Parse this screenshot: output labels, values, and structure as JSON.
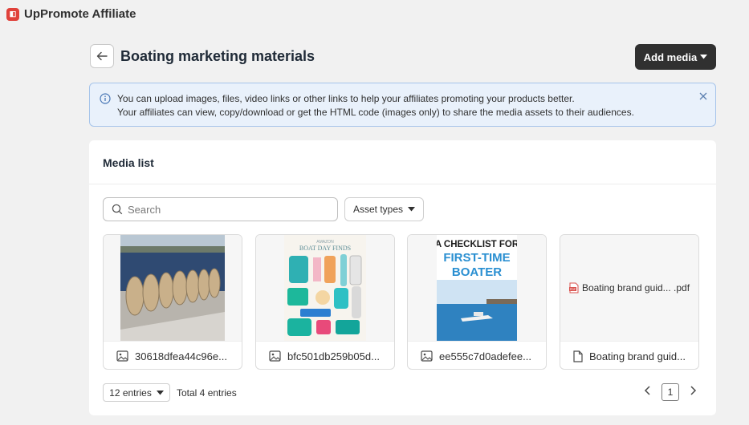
{
  "app": {
    "title": "UpPromote Affiliate",
    "logo_icon": "uppromote-logo-icon"
  },
  "header": {
    "title": "Boating marketing materials",
    "add_media_label": "Add media"
  },
  "banner": {
    "line1": "You can upload images, files, video links or other links to help your affiliates promoting your products better.",
    "line2": "Your affiliates can view, copy/download or get the HTML code (images only) to share the media assets to their audiences."
  },
  "media_list": {
    "title": "Media list",
    "search_placeholder": "Search",
    "asset_types_label": "Asset types",
    "items": [
      {
        "name": "30618dfea44c96e...",
        "type": "image",
        "icon": "image-icon"
      },
      {
        "name": "bfc501db259b05d...",
        "type": "image",
        "icon": "image-icon",
        "thumb_text_1": "AMAZON",
        "thumb_text_2": "BOAT DAY FINDS"
      },
      {
        "name": "ee555c7d0adefee...",
        "type": "image",
        "icon": "image-icon",
        "thumb_text_1": "A CHECKLIST FOR",
        "thumb_text_2": "FIRST-TIME",
        "thumb_text_3": "BOATER"
      },
      {
        "name": "Boating brand guid...",
        "type": "file",
        "icon": "file-icon",
        "thumb_label": "Boating brand guid... .pdf"
      }
    ],
    "entries_label": "12 entries",
    "total_label": "Total 4 entries",
    "current_page": "1"
  },
  "colors": {
    "primary_button": "#303030",
    "banner_bg": "#e9f1fb",
    "banner_border": "#a6c4ea",
    "logo": "#e0413a",
    "pdf_icon": "#d9534f"
  }
}
